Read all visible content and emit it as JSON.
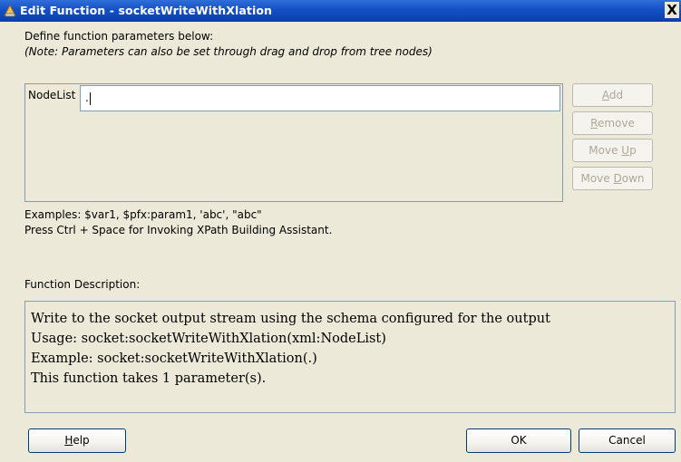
{
  "window": {
    "title": "Edit Function - socketWriteWithXlation",
    "close_glyph": "X"
  },
  "intro": {
    "line1": "Define function parameters below:",
    "line2": "(Note: Parameters can also be set through drag and drop from tree nodes)"
  },
  "parameters": {
    "name": "NodeList",
    "value": "."
  },
  "side_buttons": {
    "add": {
      "pre": "",
      "key": "A",
      "post": "dd"
    },
    "remove": {
      "pre": "",
      "key": "R",
      "post": "emove"
    },
    "move_up": {
      "pre": "Move ",
      "key": "U",
      "post": "p"
    },
    "move_down": {
      "pre": "Move ",
      "key": "D",
      "post": "own"
    }
  },
  "hints": {
    "examples": "Examples: $var1, $pfx:param1, 'abc', \"abc\"",
    "assist": "Press Ctrl + Space for Invoking XPath Building Assistant."
  },
  "description": {
    "label": "Function Description:",
    "lines": [
      "Write to the socket output stream using the schema configured for the output",
      "Usage: socket:socketWriteWithXlation(xml:NodeList)",
      "Example: socket:socketWriteWithXlation(.)",
      "This function takes 1 parameter(s)."
    ]
  },
  "footer": {
    "help": {
      "key": "H",
      "post": "elp"
    },
    "ok": "OK",
    "cancel": "Cancel"
  },
  "colors": {
    "titlebar": "#1450c6",
    "dialog_bg": "#ece9d8",
    "disabled_text": "#aca899"
  }
}
